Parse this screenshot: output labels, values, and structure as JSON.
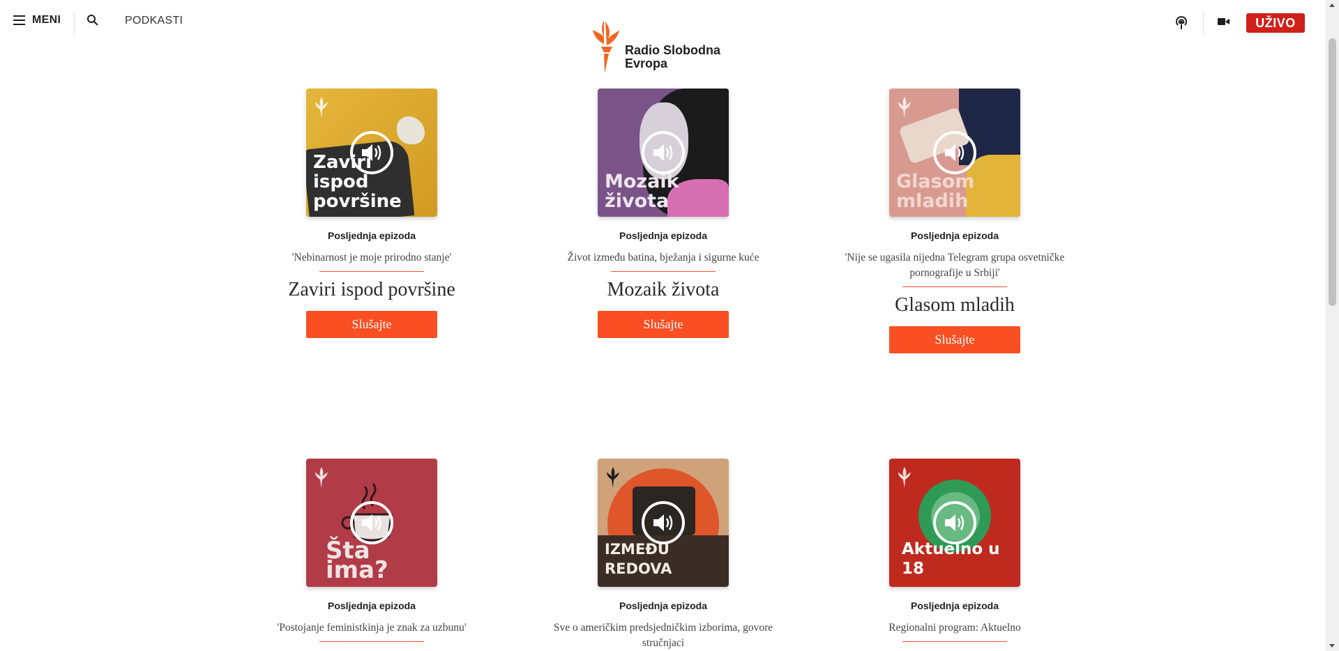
{
  "header": {
    "menu_label": "MENI",
    "nav_podcasts": "PODKASTI",
    "logo_line1": "Radio Slobodna",
    "logo_line2": "Evropa",
    "live_label": "UŽIVO",
    "accent_color": "#d0201a"
  },
  "cards": [
    {
      "cover_title": "Zaviri\nispod\npovršine",
      "cover_color": "#d9a32b",
      "latest_label": "Posljednja epizoda",
      "episode": "'Nebinarnost je moje prirodno stanje'",
      "title": "Zaviri ispod površine",
      "button": "Slušajte"
    },
    {
      "cover_title": "Mozaik\nživota",
      "cover_color": "#7d4f8e",
      "latest_label": "Posljednja epizoda",
      "episode": "Život između batina, bježanja i sigurne kuće",
      "title": "Mozaik života",
      "button": "Slušajte"
    },
    {
      "cover_title": "Glasom\nmladih",
      "cover_color": "#d99a91",
      "latest_label": "Posljednja epizoda",
      "episode": "'Nije se ugasila nijedna Telegram grupa osvetničke pornografije u Srbiji'",
      "title": "Glasom mladih",
      "button": "Slušajte"
    },
    {
      "cover_title": "Šta ima?",
      "cover_color": "#b33a45",
      "latest_label": "Posljednja epizoda",
      "episode": "'Postojanje feministkinja je znak za uzbunu'",
      "title": "",
      "button": ""
    },
    {
      "cover_title": "IZMEĐU REDOVA",
      "cover_color": "#d9a77b",
      "latest_label": "Posljednja epizoda",
      "episode": "Sve o američkim predsjedničkim izborima, govore stručnjaci",
      "title": "",
      "button": ""
    },
    {
      "cover_title": "Aktuelno u 18",
      "cover_color": "#c0281e",
      "latest_label": "Posljednja epizoda",
      "episode": "Regionalni program: Aktuelno",
      "title": "",
      "button": ""
    }
  ]
}
